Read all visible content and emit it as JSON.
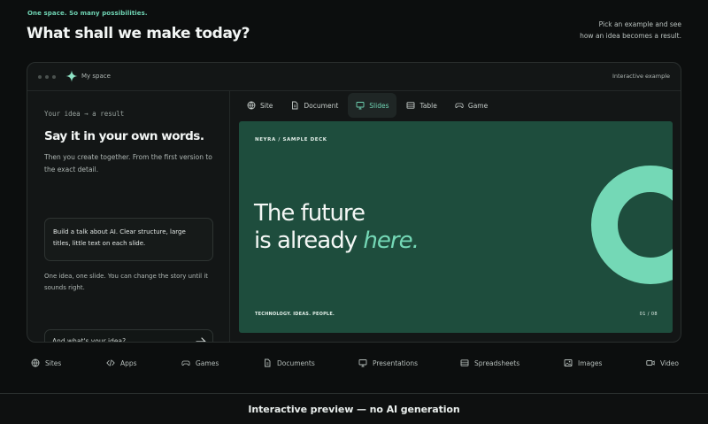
{
  "header": {
    "tagline": "One space. So many possibilities.",
    "headline": "What shall we make today?",
    "hint_line1": "Pick an example and see",
    "hint_line2": "how an idea becomes a result."
  },
  "window": {
    "space_name": "My space",
    "mode_label": "Interactive example"
  },
  "left": {
    "eyebrow": "Your idea → a result",
    "title": "Say it in your own words.",
    "description": "Then you create together. From the first version to the exact detail.",
    "prompt_text": "Build a talk about AI. Clear structure, large titles, little text on each slide.",
    "note": "One idea, one slide. You can change the story until it sounds right.",
    "input_placeholder": "And what's your idea?"
  },
  "tabs": [
    {
      "label": "Site",
      "icon": "globe-icon",
      "active": false
    },
    {
      "label": "Document",
      "icon": "document-icon",
      "active": false
    },
    {
      "label": "Slides",
      "icon": "presentation-icon",
      "active": true
    },
    {
      "label": "Table",
      "icon": "table-icon",
      "active": false
    },
    {
      "label": "Game",
      "icon": "gamepad-icon",
      "active": false
    }
  ],
  "slide": {
    "kicker": "NEYRA / SAMPLE DECK",
    "line1": "The future",
    "line2_prefix": "is already ",
    "line2_accent": "here.",
    "footer": "TECHNOLOGY. IDEAS. PEOPLE.",
    "page": "01 / 08"
  },
  "bottom_nav": [
    {
      "label": "Sites",
      "icon": "globe-icon"
    },
    {
      "label": "Apps",
      "icon": "code-icon"
    },
    {
      "label": "Games",
      "icon": "gamepad-icon"
    },
    {
      "label": "Documents",
      "icon": "document-icon"
    },
    {
      "label": "Presentations",
      "icon": "presentation-icon"
    },
    {
      "label": "Spreadsheets",
      "icon": "table-icon"
    },
    {
      "label": "Images",
      "icon": "image-icon"
    },
    {
      "label": "Video",
      "icon": "video-icon"
    }
  ],
  "footer": {
    "text": "Interactive preview — no AI generation"
  },
  "colors": {
    "accent": "#6fd3b3",
    "background": "#0c0e0e",
    "slide_bg": "#1e4d3d",
    "ring": "#74d8b6"
  }
}
